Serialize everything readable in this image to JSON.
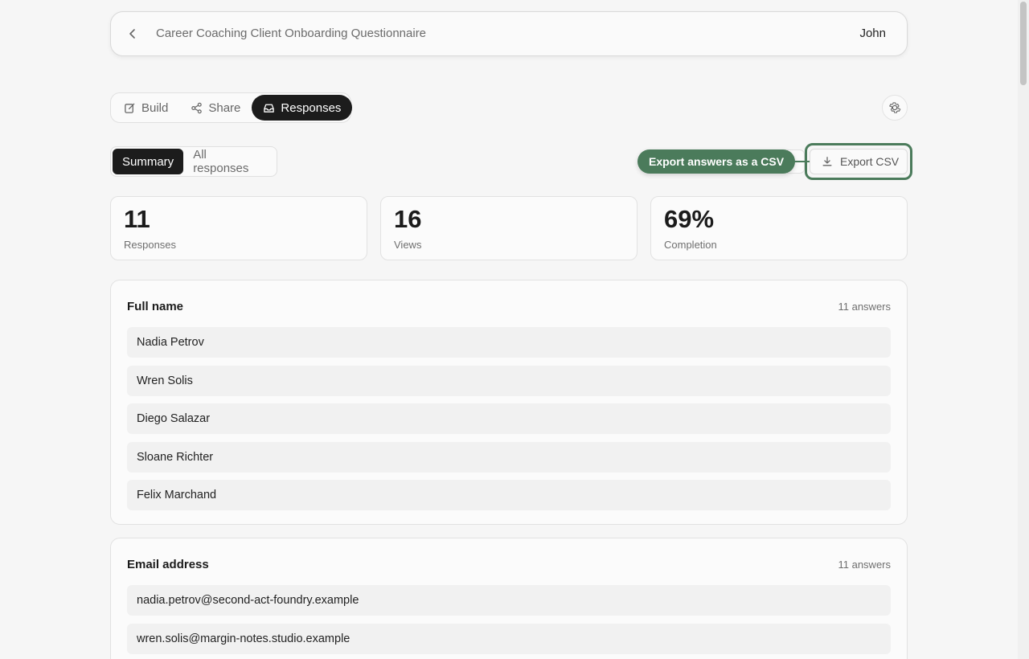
{
  "header": {
    "title": "Career Coaching Client Onboarding Questionnaire",
    "user": "John"
  },
  "tabs": {
    "build": "Build",
    "share": "Share",
    "responses": "Responses"
  },
  "subtabs": {
    "summary": "Summary",
    "all": "All responses"
  },
  "tooltip": "Export answers as a CSV",
  "export_label": "Export CSV",
  "stats": [
    {
      "value": "11",
      "label": "Responses"
    },
    {
      "value": "16",
      "label": "Views"
    },
    {
      "value": "69%",
      "label": "Completion"
    }
  ],
  "questions": [
    {
      "title": "Full name",
      "count": "11 answers",
      "answers": [
        "Nadia Petrov",
        "Wren Solis",
        "Diego Salazar",
        "Sloane Richter",
        "Felix Marchand"
      ]
    },
    {
      "title": "Email address",
      "count": "11 answers",
      "answers": [
        "nadia.petrov@second-act-foundry.example",
        "wren.solis@margin-notes.studio.example"
      ]
    }
  ]
}
